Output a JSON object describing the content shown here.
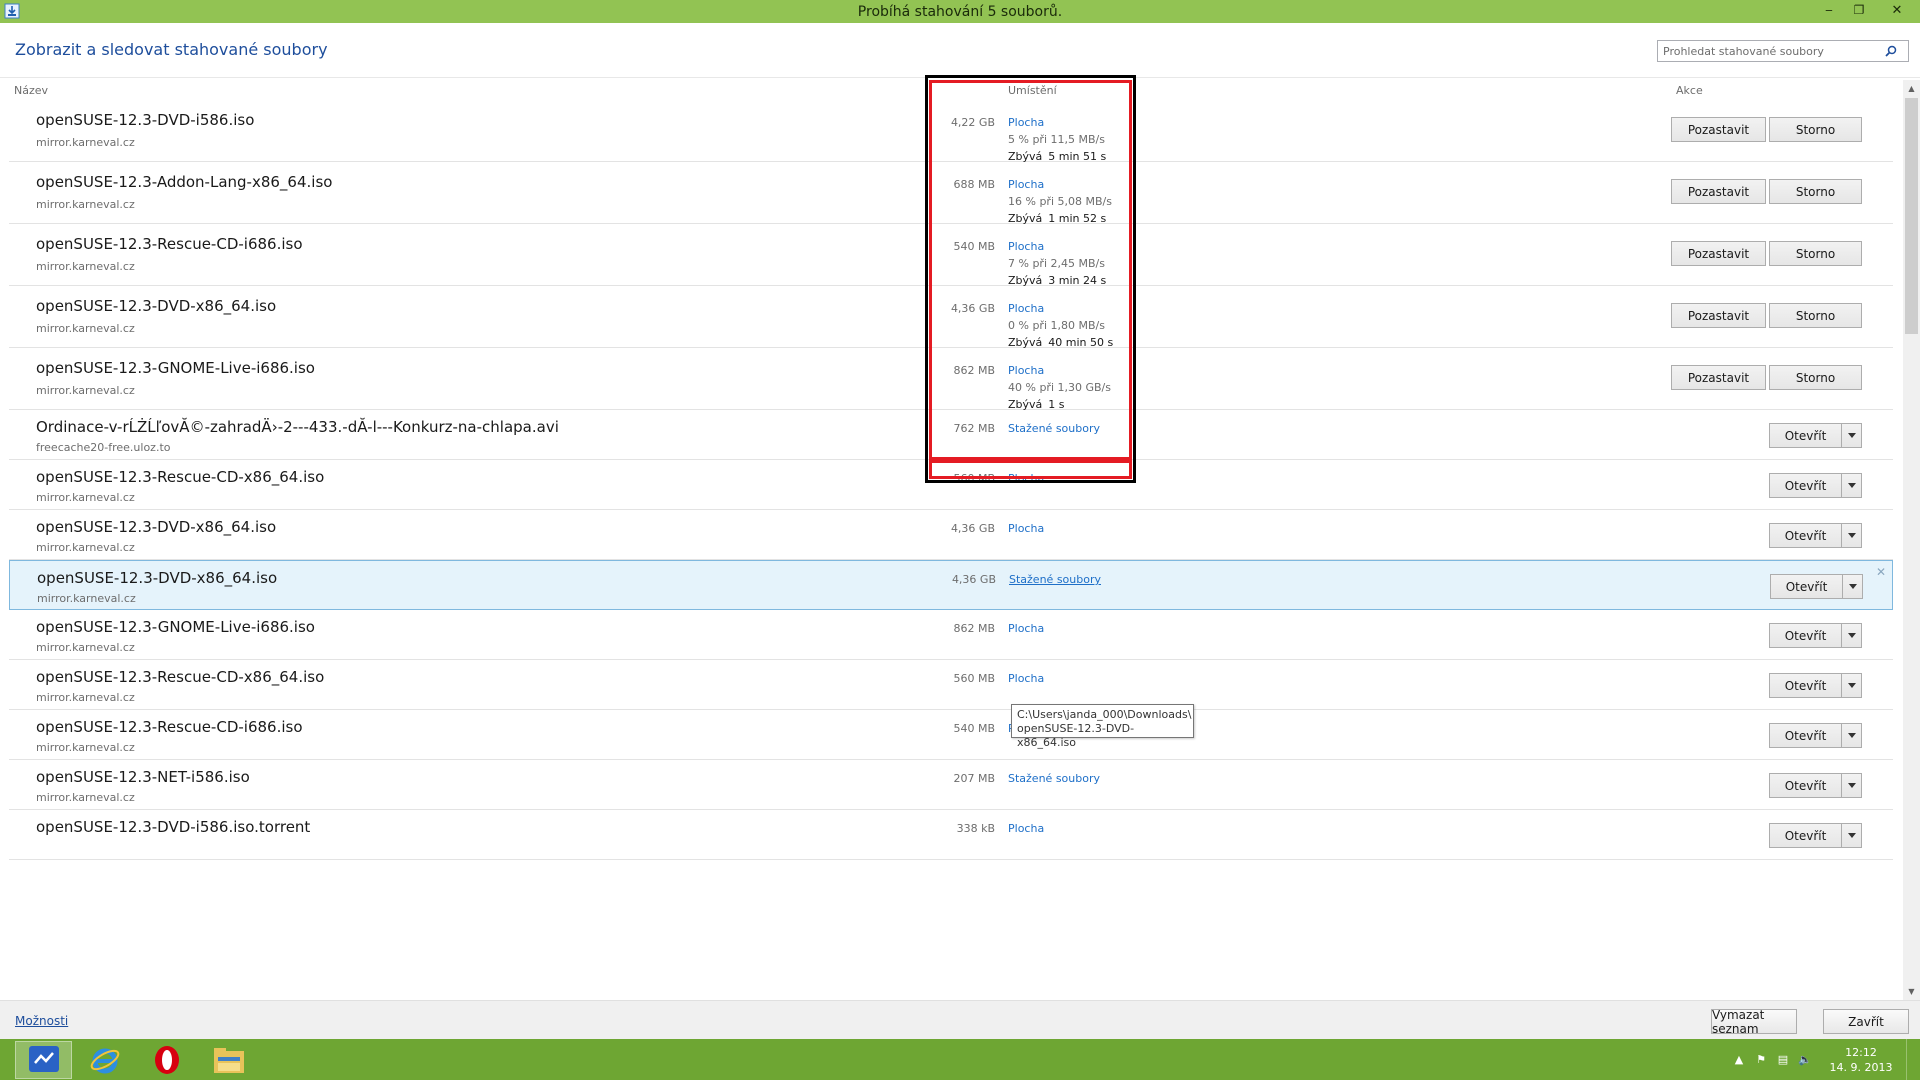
{
  "window": {
    "title": "Probíhá stahování 5 souborů.",
    "minimize": "‒",
    "restore": "❐",
    "close": "✕"
  },
  "header": {
    "title": "Zobrazit a sledovat stahované soubory",
    "search_placeholder": "Prohledat stahované soubory"
  },
  "columns": {
    "name": "Název",
    "location": "Umístění",
    "actions": "Akce"
  },
  "active_downloads": [
    {
      "name": "openSUSE-12.3-DVD-i586.iso",
      "source": "mirror.karneval.cz",
      "size": "4,22 GB",
      "location": "Plocha",
      "progress": "5 % při 11,5 MB/s",
      "remaining_label": "Zbývá",
      "remaining": "5 min 51 s",
      "pause": "Pozastavit",
      "cancel": "Storno"
    },
    {
      "name": "openSUSE-12.3-Addon-Lang-x86_64.iso",
      "source": "mirror.karneval.cz",
      "size": "688 MB",
      "location": "Plocha",
      "progress": "16 % při 5,08 MB/s",
      "remaining_label": "Zbývá",
      "remaining": "1 min 52 s",
      "pause": "Pozastavit",
      "cancel": "Storno"
    },
    {
      "name": "openSUSE-12.3-Rescue-CD-i686.iso",
      "source": "mirror.karneval.cz",
      "size": "540 MB",
      "location": "Plocha",
      "progress": "7 % při 2,45 MB/s",
      "remaining_label": "Zbývá",
      "remaining": "3 min 24 s",
      "pause": "Pozastavit",
      "cancel": "Storno"
    },
    {
      "name": "openSUSE-12.3-DVD-x86_64.iso",
      "source": "mirror.karneval.cz",
      "size": "4,36 GB",
      "location": "Plocha",
      "progress": "0 % při 1,80 MB/s",
      "remaining_label": "Zbývá",
      "remaining": "40 min 50 s",
      "pause": "Pozastavit",
      "cancel": "Storno"
    },
    {
      "name": "openSUSE-12.3-GNOME-Live-i686.iso",
      "source": "mirror.karneval.cz",
      "size": "862 MB",
      "location": "Plocha",
      "progress": "40 % při 1,30 GB/s",
      "remaining_label": "Zbývá",
      "remaining": "1 s",
      "pause": "Pozastavit",
      "cancel": "Storno"
    }
  ],
  "completed_downloads": [
    {
      "name": "Ordinace-v-rĹŻĹľovĂ©-zahradÄ›-2---433.-dĂ-l---Konkurz-na-chlapa.avi",
      "source": "freecache20-free.uloz.to",
      "size": "762 MB",
      "location": "Stažené soubory",
      "open": "Otevřít"
    },
    {
      "name": "openSUSE-12.3-Rescue-CD-x86_64.iso",
      "source": "mirror.karneval.cz",
      "size": "560 MB",
      "location": "Plocha",
      "open": "Otevřít"
    },
    {
      "name": "openSUSE-12.3-DVD-x86_64.iso",
      "source": "mirror.karneval.cz",
      "size": "4,36 GB",
      "location": "Plocha",
      "open": "Otevřít"
    },
    {
      "name": "openSUSE-12.3-DVD-x86_64.iso",
      "source": "mirror.karneval.cz",
      "size": "4,36 GB",
      "location": "Stažené soubory",
      "open": "Otevřít",
      "selected": true
    },
    {
      "name": "openSUSE-12.3-GNOME-Live-i686.iso",
      "source": "mirror.karneval.cz",
      "size": "862 MB",
      "location": "Plocha",
      "open": "Otevřít"
    },
    {
      "name": "openSUSE-12.3-Rescue-CD-x86_64.iso",
      "source": "mirror.karneval.cz",
      "size": "560 MB",
      "location": "Plocha",
      "open": "Otevřít"
    },
    {
      "name": "openSUSE-12.3-Rescue-CD-i686.iso",
      "source": "mirror.karneval.cz",
      "size": "540 MB",
      "location": "Plocha",
      "open": "Otevřít"
    },
    {
      "name": "openSUSE-12.3-NET-i586.iso",
      "source": "mirror.karneval.cz",
      "size": "207 MB",
      "location": "Stažené soubory",
      "open": "Otevřít"
    },
    {
      "name": "openSUSE-12.3-DVD-i586.iso.torrent",
      "source": "",
      "size": "338 kB",
      "location": "Plocha",
      "open": "Otevřít"
    }
  ],
  "tooltip": {
    "line1": "C:\\Users\\janda_000\\Downloads\\",
    "line2": "openSUSE-12.3-DVD-x86_64.iso"
  },
  "footer": {
    "options": "Možnosti",
    "clear": "Vymazat seznam",
    "close": "Zavřít"
  },
  "taskbar": {
    "apps": [
      "messenger-icon",
      "internet-explorer-icon",
      "opera-icon",
      "file-explorer-icon"
    ],
    "clock_time": "12:12",
    "clock_date": "14. 9. 2013"
  },
  "colors": {
    "titlebar": "#92c353",
    "taskbar": "#6ea633",
    "link": "#1e6fc8",
    "annotation_red": "#e41b23"
  }
}
